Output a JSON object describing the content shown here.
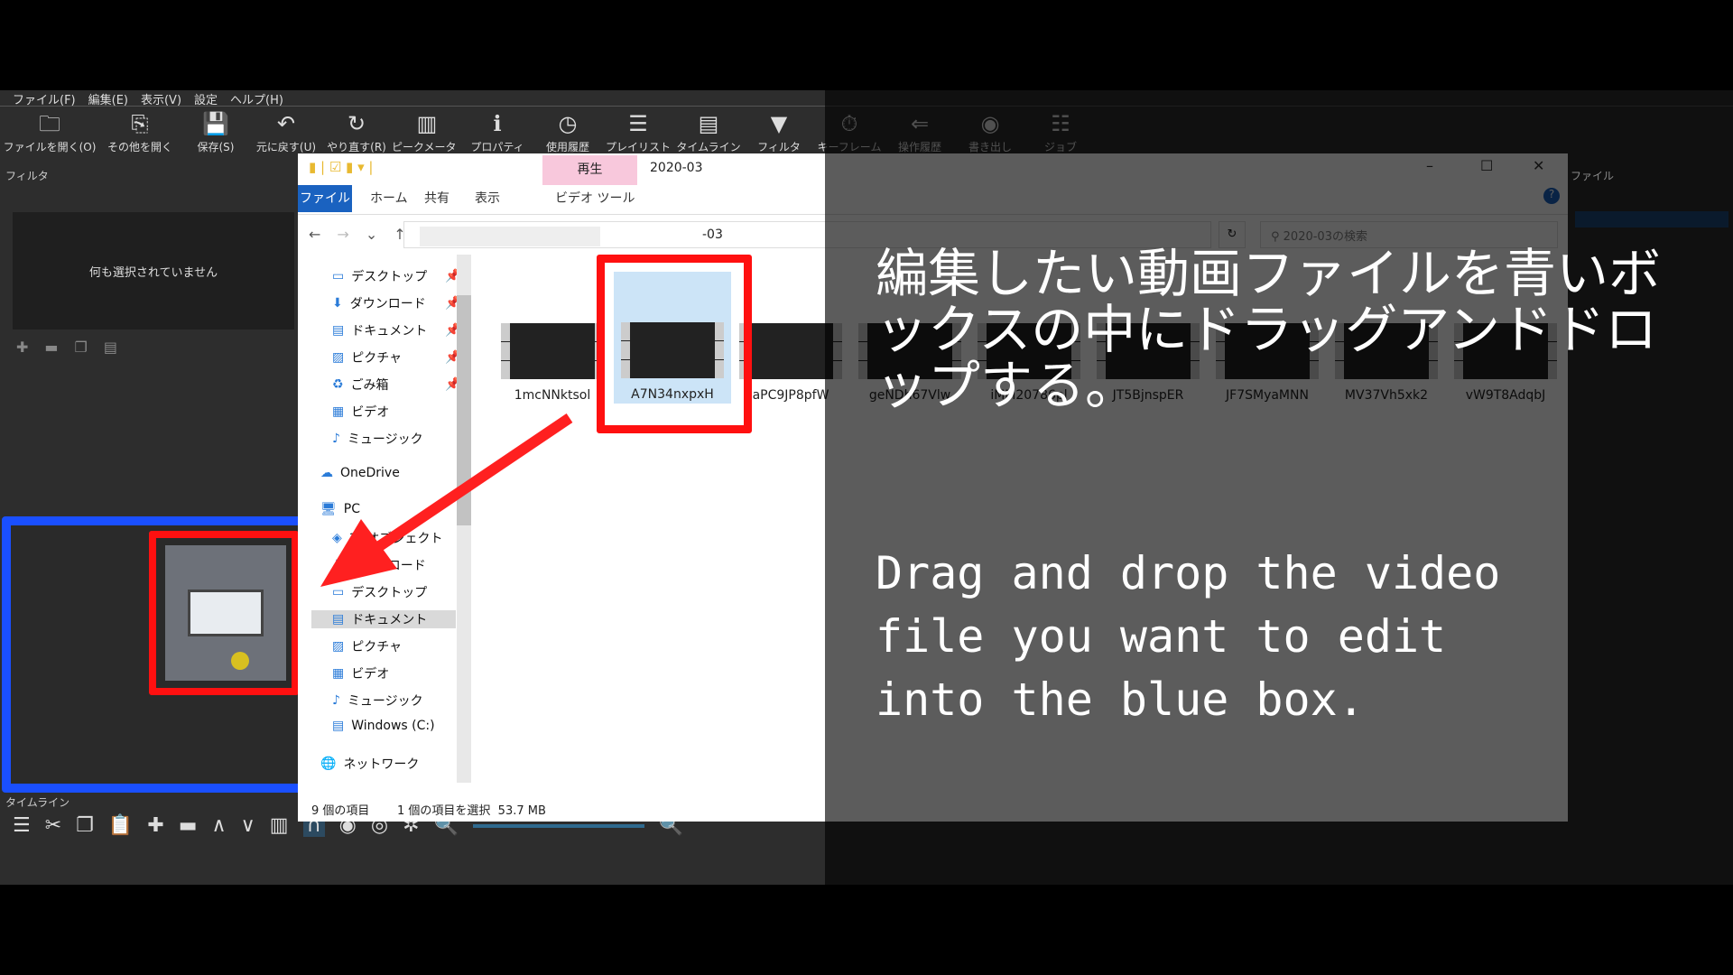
{
  "app": {
    "menu": [
      "ファイル(F)",
      "編集(E)",
      "表示(V)",
      "設定",
      "ヘルプ(H)"
    ],
    "toolbar": [
      {
        "icon": "folder-open-icon",
        "label": "ファイルを開く(O)"
      },
      {
        "icon": "open-other-icon",
        "label": "その他を開く"
      },
      {
        "icon": "save-icon",
        "label": "保存(S)"
      },
      {
        "icon": "undo-icon",
        "label": "元に戻す(U)"
      },
      {
        "icon": "redo-icon",
        "label": "やり直す(R)"
      },
      {
        "icon": "peak-meter-icon",
        "label": "ピークメーター"
      },
      {
        "icon": "info-icon",
        "label": "プロパティ"
      },
      {
        "icon": "clock-icon",
        "label": "使用履歴"
      },
      {
        "icon": "list-icon",
        "label": "プレイリスト"
      },
      {
        "icon": "timeline-icon",
        "label": "タイムライン"
      },
      {
        "icon": "filter-icon",
        "label": "フィルタ"
      },
      {
        "icon": "stopwatch-icon",
        "label": "キーフレーム"
      },
      {
        "icon": "history-icon",
        "label": "操作履歴"
      },
      {
        "icon": "export-icon",
        "label": "書き出し"
      },
      {
        "icon": "jobs-icon",
        "label": "ジョブ"
      }
    ],
    "filter_label": "フィルタ",
    "filter_empty": "何も選択されていません",
    "timeline_label": "タイムライン",
    "right_panel_label": "ファイル"
  },
  "explorer": {
    "title": "2020-03",
    "context_tab": "再生",
    "tabs": [
      "ファイル",
      "ホーム",
      "共有",
      "表示",
      "ビデオ ツール"
    ],
    "address_suffix": "-03",
    "search_placeholder": "2020-03の検索",
    "nav": [
      "デスクトップ",
      "ダウンロード",
      "ドキュメント",
      "ピクチャ",
      "ごみ箱",
      "ビデオ",
      "ミュージック",
      "OneDrive",
      "PC",
      "3Dオブジェクト",
      "ダウンロード",
      "デスクトップ",
      "ドキュメント",
      "ピクチャ",
      "ビデオ",
      "ミュージック",
      "Windows (C:)",
      "ネットワーク"
    ],
    "files": [
      "1mcNNktsol",
      "A7N34nxpxH",
      "aPC9JP8pfW",
      "geNDh67Vlw",
      "iMM20786pl",
      "JT5BjnspER",
      "JF7SMyaMNN",
      "MV37Vh5xk2",
      "vW9T8AdqbJ"
    ],
    "selected_file": "A7N34nxpxH",
    "status_count": "9 個の項目",
    "status_selected": "1 個の項目を選択  53.7 MB"
  },
  "overlay": {
    "jp": "編集したい動画ファイルを青いボックスの中にドラッグアンドドロップする。",
    "en": "Drag and drop the video\nfile you want to edit\ninto the blue box.",
    "colors": {
      "blue_box": "#1a4fff",
      "red_box": "#ff1010",
      "arrow": "#ff2020"
    }
  }
}
